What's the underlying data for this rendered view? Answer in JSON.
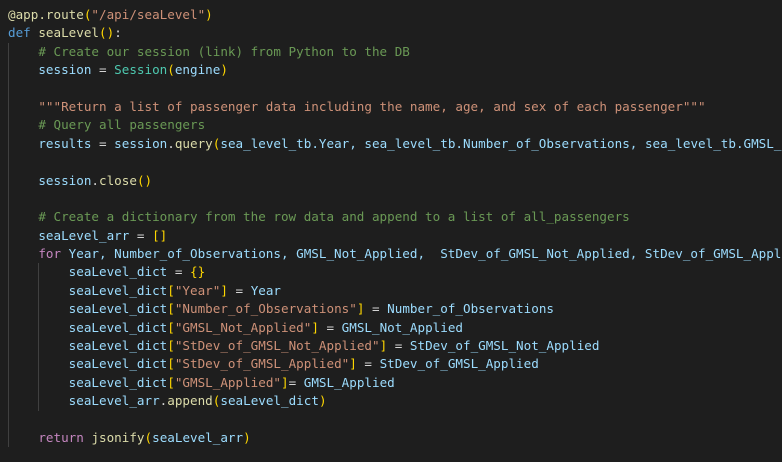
{
  "editor": {
    "language": "python",
    "theme": "dark",
    "colors": {
      "background": "#1e1e1e",
      "keyword": "#569cd6",
      "control": "#c586c0",
      "function": "#dcdcaa",
      "string": "#ce9178",
      "comment": "#6a9955",
      "variable": "#9cdcfe",
      "class": "#4ec9b0"
    }
  },
  "code": {
    "l1": {
      "decorator": "@app.route",
      "paren_open": "(",
      "route": "\"/api/seaLevel\"",
      "paren_close": ")"
    },
    "l2": {
      "def": "def",
      "name": "seaLevel",
      "parens": "()",
      "colon": ":"
    },
    "l3": {
      "comment": "# Create our session (link) from Python to the DB"
    },
    "l4": {
      "lhs": "session",
      "eq": " = ",
      "cls": "Session",
      "paren_open": "(",
      "arg": "engine",
      "paren_close": ")"
    },
    "l6": {
      "docstring": "\"\"\"Return a list of passenger data including the name, age, and sex of each passenger\"\"\""
    },
    "l7": {
      "comment": "# Query all passengers"
    },
    "l8": {
      "lhs": "results",
      "eq": " = ",
      "obj": "session",
      "dot": ".",
      "method": "query",
      "paren_open": "(",
      "args": "sea_level_tb.Year, sea_level_tb.Number_of_Observations, sea_level_tb.GMSL_"
    },
    "l10": {
      "obj": "session",
      "dot": ".",
      "method": "close",
      "parens": "()"
    },
    "l12": {
      "comment": "# Create a dictionary from the row data and append to a list of all_passengers"
    },
    "l13": {
      "lhs": "seaLevel_arr",
      "eq": " = ",
      "val": "[]"
    },
    "l14": {
      "for": "for",
      "vars": " Year, Number_of_Observations, GMSL_Not_Applied,  StDev_of_GMSL_Not_Applied, StDev_of_GMSL_Appl"
    },
    "l15": {
      "lhs": "seaLevel_dict",
      "eq": " = ",
      "val": "{}"
    },
    "l16": {
      "obj": "seaLevel_dict",
      "bo": "[",
      "key": "\"Year\"",
      "bc": "]",
      "eq": " = ",
      "rhs": "Year"
    },
    "l17": {
      "obj": "seaLevel_dict",
      "bo": "[",
      "key": "\"Number_of_Observations\"",
      "bc": "]",
      "eq": " = ",
      "rhs": "Number_of_Observations"
    },
    "l18": {
      "obj": "seaLevel_dict",
      "bo": "[",
      "key": "\"GMSL_Not_Applied\"",
      "bc": "]",
      "eq": " = ",
      "rhs": "GMSL_Not_Applied"
    },
    "l19": {
      "obj": "seaLevel_dict",
      "bo": "[",
      "key": "\"StDev_of_GMSL_Not_Applied\"",
      "bc": "]",
      "eq": " = ",
      "rhs": "StDev_of_GMSL_Not_Applied"
    },
    "l20": {
      "obj": "seaLevel_dict",
      "bo": "[",
      "key": "\"StDev_of_GMSL_Applied\"",
      "bc": "]",
      "eq": " = ",
      "rhs": "StDev_of_GMSL_Applied"
    },
    "l21": {
      "obj": "seaLevel_dict",
      "bo": "[",
      "key": "\"GMSL_Applied\"",
      "bc": "]",
      "eq": "= ",
      "rhs": "GMSL_Applied"
    },
    "l22": {
      "obj": "seaLevel_arr",
      "dot": ".",
      "method": "append",
      "paren_open": "(",
      "arg": "seaLevel_dict",
      "paren_close": ")"
    },
    "l24": {
      "ret": "return",
      "fn": "jsonify",
      "paren_open": "(",
      "arg": "seaLevel_arr",
      "paren_close": ")"
    }
  }
}
